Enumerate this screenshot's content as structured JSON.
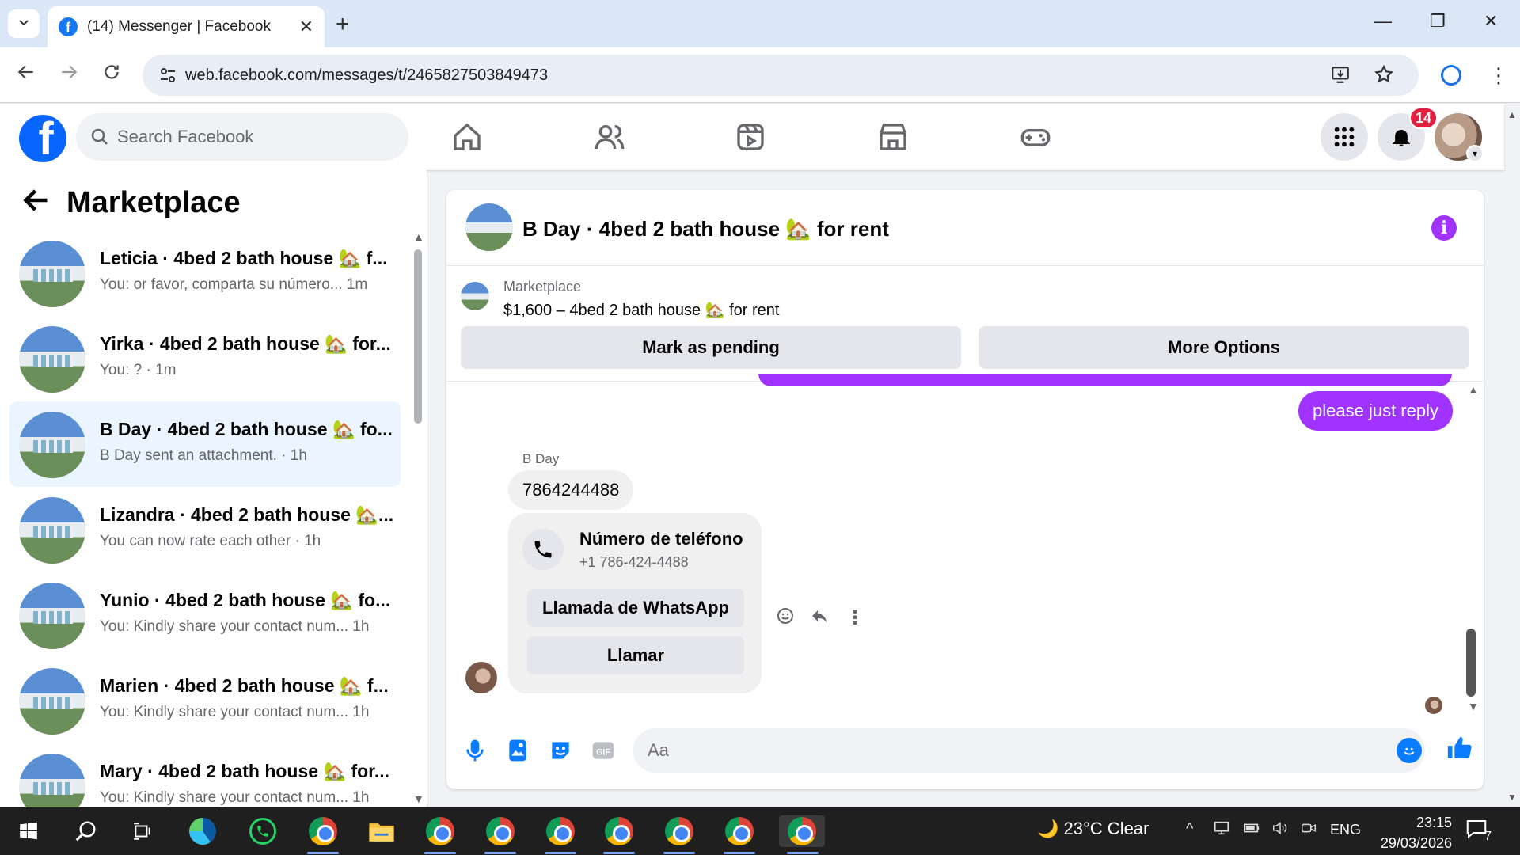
{
  "browser": {
    "tab_title": "(14) Messenger | Facebook",
    "tab_close": "✕",
    "new_tab": "+",
    "url": "web.facebook.com/messages/t/2465827503849473",
    "win_min": "—",
    "win_restore": "❐",
    "win_close": "✕"
  },
  "fb": {
    "logo_letter": "f",
    "search_placeholder": "Search Facebook",
    "notification_count": "14",
    "brand_color": "#0866ff"
  },
  "sidebar": {
    "title": "Marketplace",
    "conversations": [
      {
        "name": "Leticia · 4bed 2 bath house 🏡 f...",
        "preview": "You: or favor, comparta su número... 1m",
        "active": false
      },
      {
        "name": "Yirka · 4bed 2 bath house 🏡 for...",
        "preview": "You: ? · 1m",
        "active": false
      },
      {
        "name": "B Day · 4bed 2 bath house 🏡 fo...",
        "preview": "B Day sent an attachment. · 1h",
        "active": true
      },
      {
        "name": "Lizandra · 4bed 2 bath house 🏡...",
        "preview": "You can now rate each other · 1h",
        "active": false
      },
      {
        "name": "Yunio · 4bed 2 bath house 🏡 fo...",
        "preview": "You: Kindly share your contact num... 1h",
        "active": false
      },
      {
        "name": "Marien · 4bed 2 bath house 🏡 f...",
        "preview": "You: Kindly share your contact num... 1h",
        "active": false
      },
      {
        "name": "Mary · 4bed 2 bath house 🏡 for...",
        "preview": "You: Kindly share your contact num... 1h",
        "active": false
      }
    ]
  },
  "chat": {
    "title": "B Day · 4bed 2 bath house 🏡 for rent",
    "info_icon": "i",
    "listing_label": "Marketplace",
    "listing_title": "$1,600 – 4bed 2 bath house 🏡 for rent",
    "btn_pending": "Mark as pending",
    "btn_more": "More Options",
    "my_message": "please just reply",
    "sender_name": "B Day",
    "their_message": "7864244488",
    "card_title": "Número de teléfono",
    "card_number": "+1 786-424-4488",
    "btn_whatsapp": "Llamada de WhatsApp",
    "btn_call": "Llamar",
    "input_placeholder": "Aa",
    "accent_color": "#a033ff"
  },
  "taskbar": {
    "weather": "23°C  Clear",
    "lang": "ENG",
    "time": "23:15",
    "date": "29/03/2026",
    "notif_count": "7"
  }
}
